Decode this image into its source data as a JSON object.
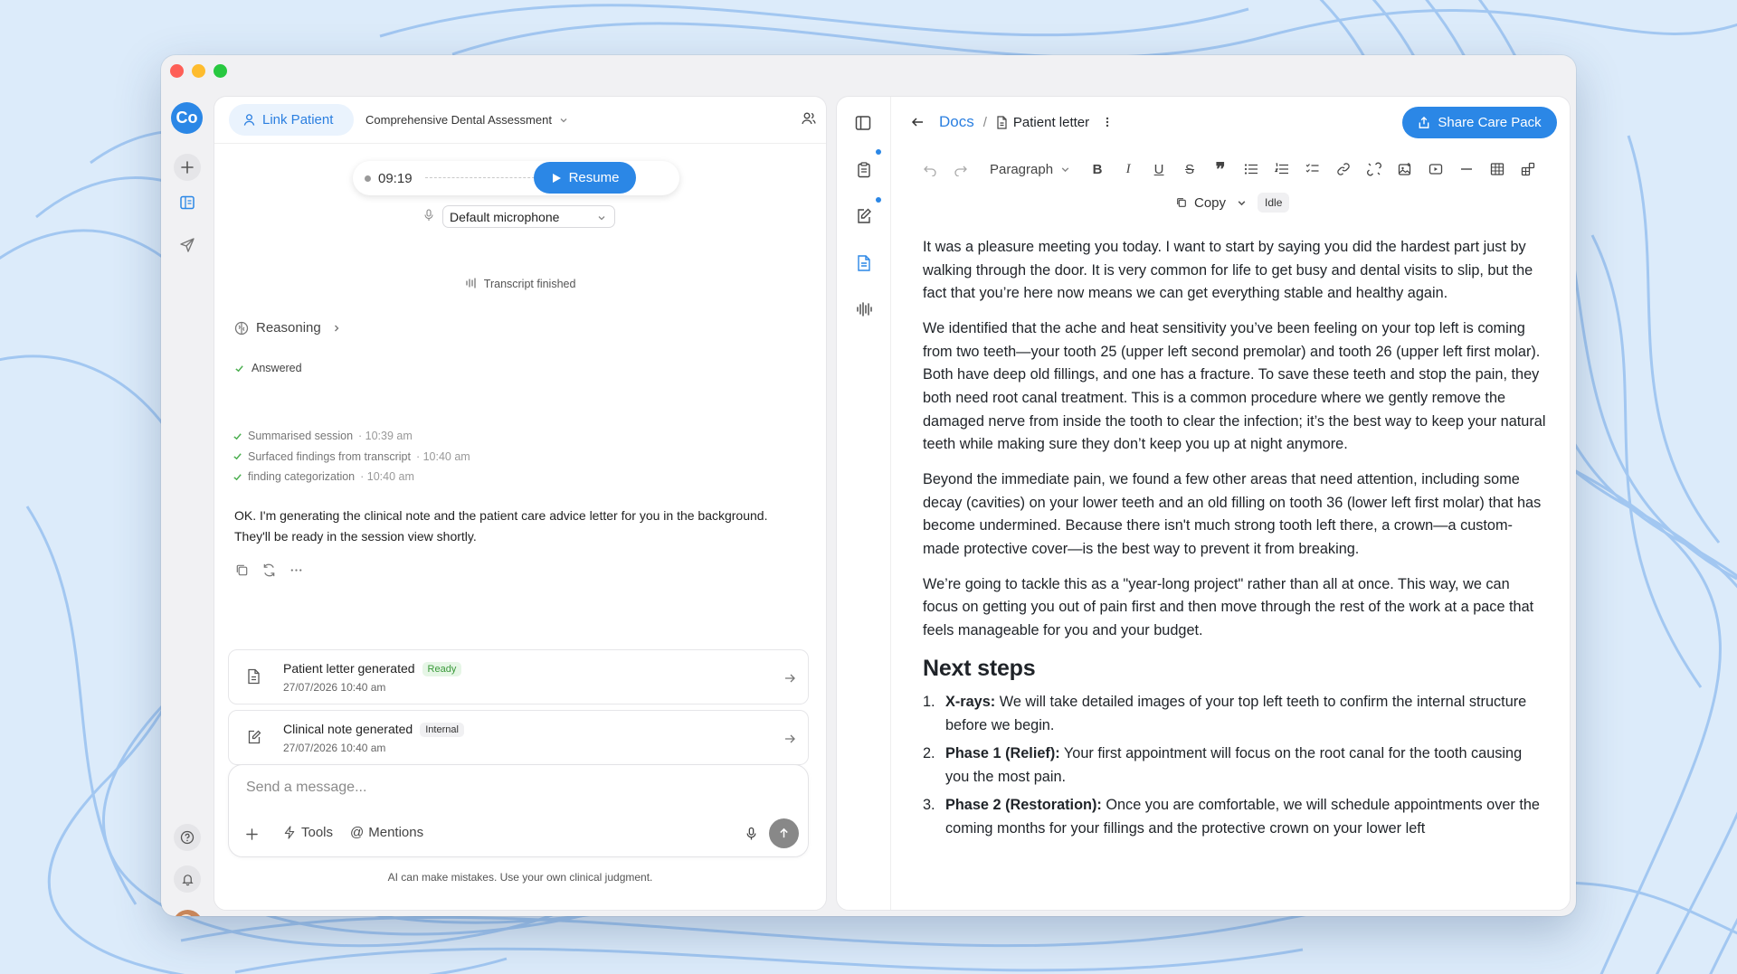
{
  "window": {
    "controls": {
      "close_color": "#fe5f57",
      "minimize_color": "#febc2e",
      "maximize_color": "#28c840"
    }
  },
  "rail": {
    "logo": "Co",
    "icons": [
      "plus-icon",
      "sidebar-panel-icon",
      "send-icon",
      "help-icon",
      "bell-icon"
    ],
    "accent": "#2b87e6"
  },
  "chat": {
    "link_patient": "Link Patient",
    "session_title": "Comprehensive Dental Assessment",
    "recorder": {
      "time": "09:19",
      "resume": "Resume",
      "microphone": "Default microphone"
    },
    "transcript_status": "Transcript finished",
    "reasoning": "Reasoning",
    "answered": "Answered",
    "steps": [
      {
        "label": "Summarised session",
        "time": "· 10:39 am"
      },
      {
        "label": "Surfaced findings from transcript",
        "time": "· 10:40 am"
      },
      {
        "label": "finding categorization",
        "time": "· 10:40 am"
      }
    ],
    "message": "OK. I'm generating the clinical note and the patient care advice letter for you in the background. They'll be ready in the session view shortly.",
    "cards": [
      {
        "title": "Patient letter generated",
        "badge": "Ready",
        "date": "27/07/2026 10:40 am",
        "badge_bg": "#e6f6e6",
        "badge_fg": "#3a9a3a"
      },
      {
        "title": "Clinical note generated",
        "badge": "Internal",
        "date": "27/07/2026 10:40 am",
        "badge_bg": "#f0f0f2",
        "badge_fg": "#333333"
      }
    ],
    "composer": {
      "placeholder": "Send a message...",
      "tools": "Tools",
      "mentions": "Mentions"
    },
    "disclaimer": "AI can make mistakes. Use your own clinical judgment."
  },
  "doc": {
    "breadcrumb_root": "Docs",
    "separator": "/",
    "doc_title": "Patient letter",
    "share": "Share Care Pack",
    "toolbar": {
      "paragraph": "Paragraph",
      "copy": "Copy",
      "status": "Idle"
    },
    "paragraphs": [
      "It was a pleasure meeting you today. I want to start by saying you did the hardest part just by walking through the door. It is very common for life to get busy and dental visits to slip, but the fact that you’re here now means we can get everything stable and healthy again.",
      "We identified that the ache and heat sensitivity you’ve been feeling on your top left is coming from two teeth—your tooth 25 (upper left second premolar) and tooth 26 (upper left first molar). Both have deep old fillings, and one has a fracture. To save these teeth and stop the pain, they both need root canal treatment. This is a common procedure where we gently remove the damaged nerve from inside the tooth to clear the infection; it’s the best way to keep your natural teeth while making sure they don’t keep you up at night anymore.",
      "Beyond the immediate pain, we found a few other areas that need attention, including some decay (cavities) on your lower teeth and an old filling on tooth 36 (lower left first molar) that has become undermined. Because there isn't much strong tooth left there, a crown—a custom-made protective cover—is the best way to prevent it from breaking.",
      "We’re going to tackle this as a \"year-long project\" rather than all at once. This way, we can focus on getting you out of pain first and then move through the rest of the work at a pace that feels manageable for you and your budget."
    ],
    "heading": "Next steps",
    "steps": [
      {
        "num": "1.",
        "bold": "X-rays:",
        "text": " We will take detailed images of your top left teeth to confirm the internal structure before we begin."
      },
      {
        "num": "2.",
        "bold": "Phase 1 (Relief):",
        "text": " Your first appointment will focus on the root canal for the tooth causing you the most pain."
      },
      {
        "num": "3.",
        "bold": "Phase 2 (Restoration):",
        "text": " Once you are comfortable, we will schedule appointments over the coming months for your fillings and the protective crown on your lower left"
      }
    ]
  }
}
